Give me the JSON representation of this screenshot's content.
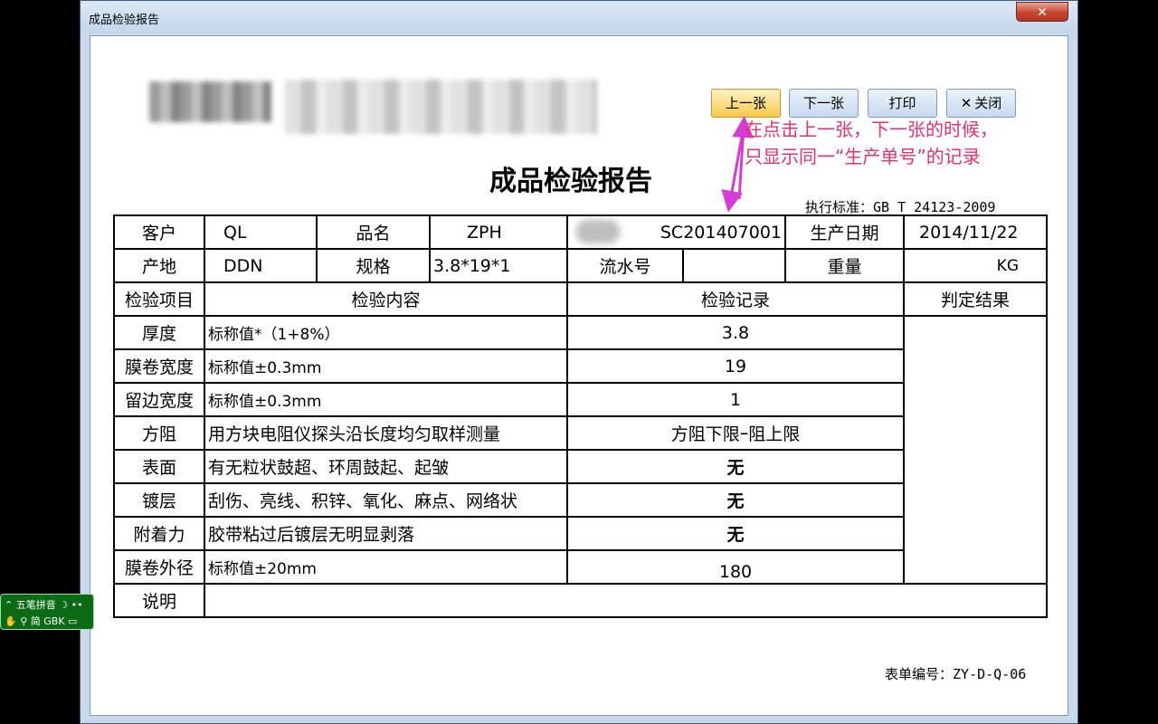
{
  "window": {
    "title": "成品检验报告",
    "close_label": "✕"
  },
  "toolbar": {
    "prev_label": "上一张",
    "next_label": "下一张",
    "print_label": "打印",
    "close_label": "关闭"
  },
  "annotation": {
    "line1": "在点击上一张，下一张的时候，",
    "line2": "只显示同一“生产单号”的记录"
  },
  "report": {
    "title": "成品检验报告",
    "standard": "执行标准：GB_T 24123-2009",
    "form_no": "表单编号：ZY-D-Q-06",
    "customer_label": "客户",
    "customer": "QL",
    "product_label": "品名",
    "product": "ZPH",
    "order_no": "SC201407001",
    "date_label": "生产日期",
    "date": "2014/11/22",
    "origin_label": "产地",
    "origin": "DDN",
    "spec_label": "规格",
    "spec": "3.8*19*1",
    "serial_label": "流水号",
    "serial": "",
    "weight_label": "重量",
    "weight_unit": "KG",
    "headers": {
      "item": "检验项目",
      "content": "检验内容",
      "record": "检验记录",
      "result": "判定结果"
    },
    "rows": [
      {
        "item": "厚度",
        "content": "标称值*（1+8%）",
        "record": "3.8"
      },
      {
        "item": "膜卷宽度",
        "content": "标称值±0.3mm",
        "record": "19"
      },
      {
        "item": "留边宽度",
        "content": "标称值±0.3mm",
        "record": "1"
      },
      {
        "item": "方阻",
        "content": "用方块电阻仪探头沿长度均匀取样测量",
        "record": "方阻下限ｰ阻上限"
      },
      {
        "item": "表面",
        "content": "有无粒状鼓超、环周鼓起、起皱",
        "record": "无"
      },
      {
        "item": "镀层",
        "content": "刮伤、亮线、积锌、氧化、麻点、网络状",
        "record": "无"
      },
      {
        "item": "附着力",
        "content": "胶带粘过后镀层无明显剥落",
        "record": "无"
      },
      {
        "item": "膜卷外径",
        "content": "标称值±20mm",
        "record": "180"
      }
    ],
    "notes_label": "说明"
  },
  "ime": {
    "line1": "五笔拼音",
    "line2": "简 GBK"
  }
}
